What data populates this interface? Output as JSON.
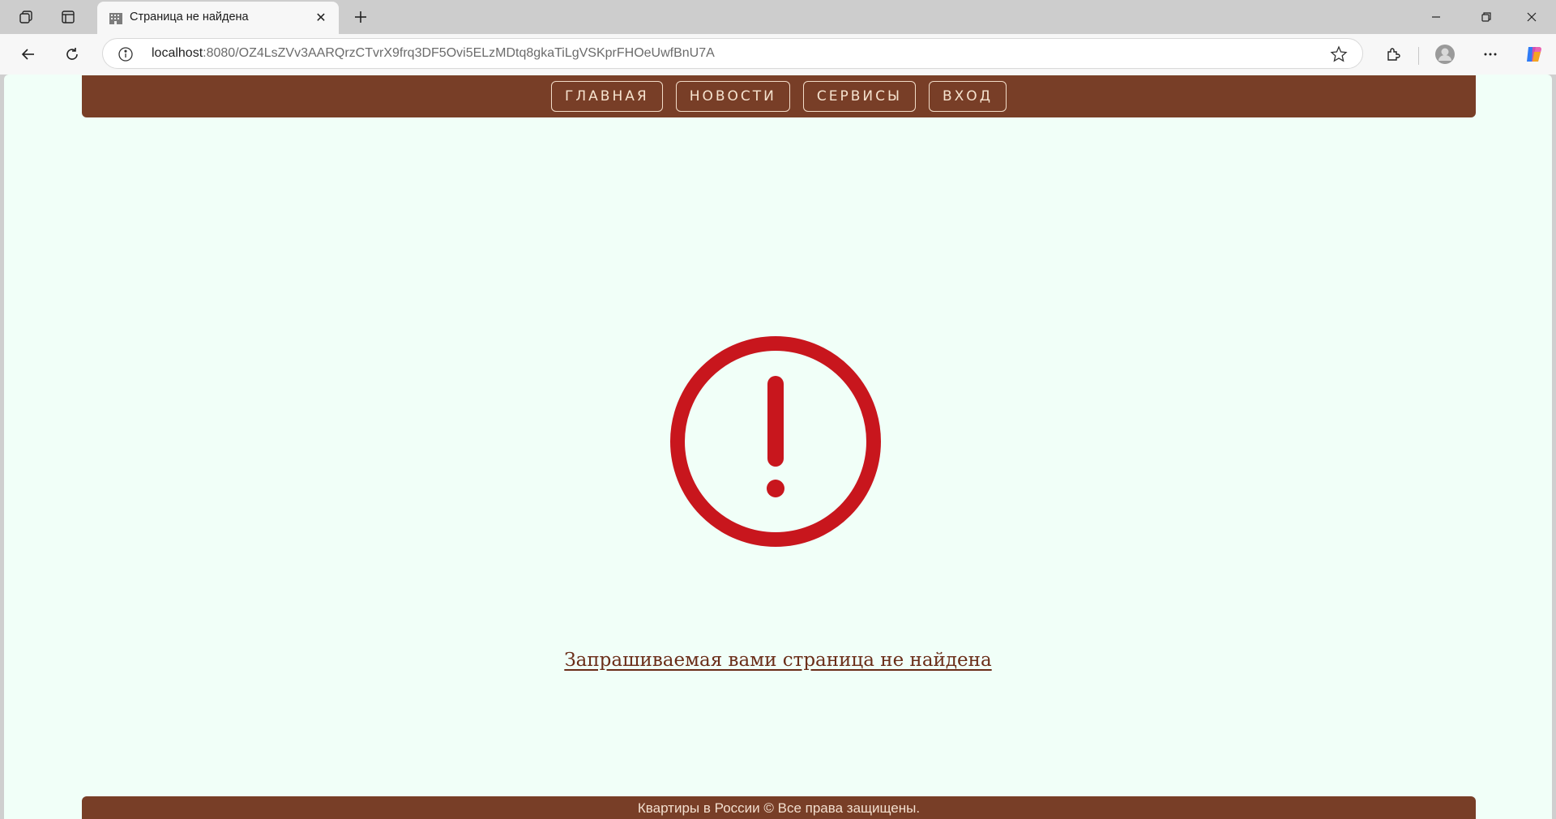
{
  "browser": {
    "tab_title": "Страница не найдена",
    "url_host": "localhost",
    "url_path": ":8080/OZ4LsZVv3AARQrzCTvrX9frq3DF5Ovi5ELzMDtq8gkaTiLgVSKprFHOeUwfBnU7A"
  },
  "nav": {
    "items": [
      {
        "label": "ГЛАВНАЯ"
      },
      {
        "label": "НОВОСТИ"
      },
      {
        "label": "СЕРВИСЫ"
      },
      {
        "label": "ВХОД"
      }
    ]
  },
  "main": {
    "error_message": "Запрашиваемая вами страница не найдена",
    "error_icon": "exclamation-circle-icon",
    "error_color": "#c8161d"
  },
  "footer": {
    "text": "Квартиры в России © Все права защищены."
  },
  "colors": {
    "brand": "#783e27",
    "page_background": "#f1fff8"
  }
}
